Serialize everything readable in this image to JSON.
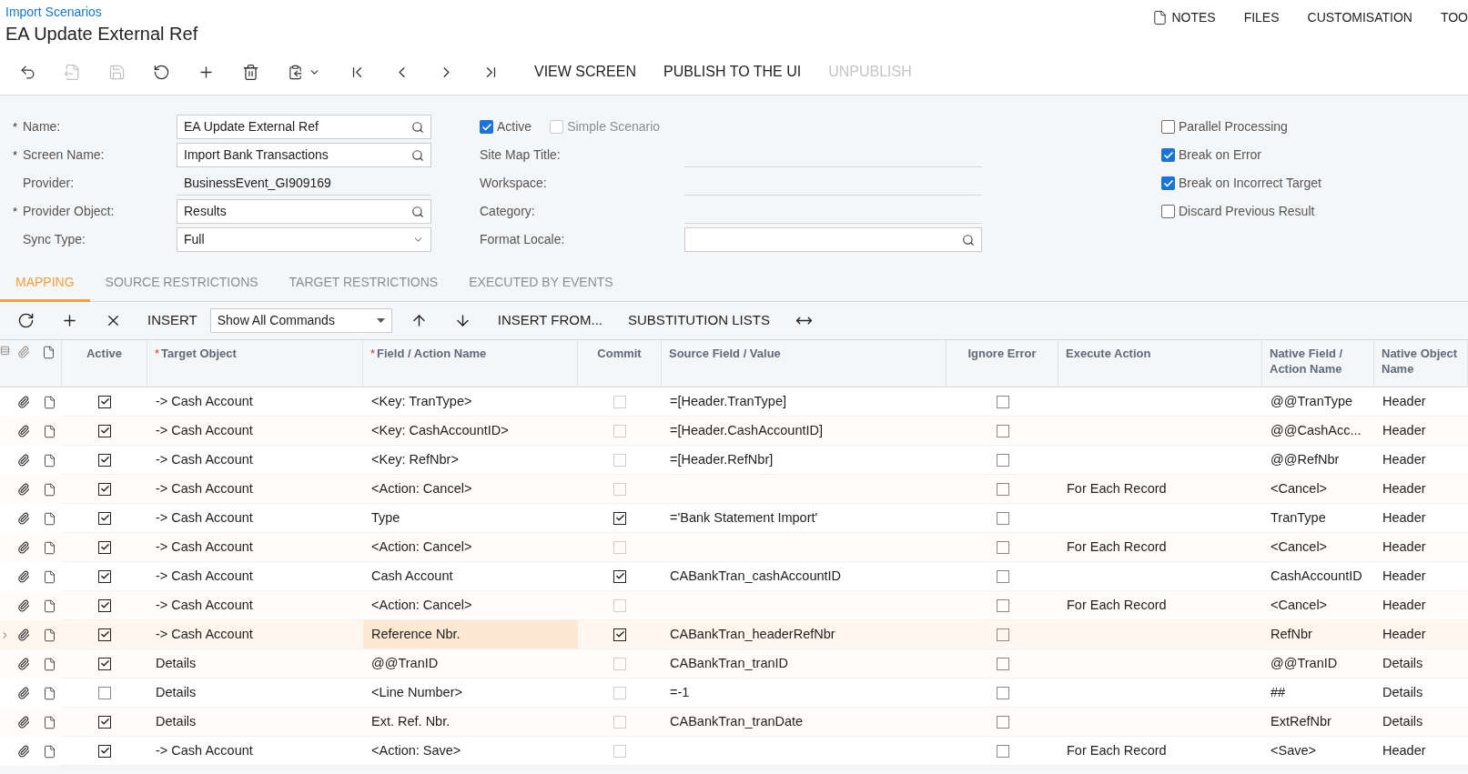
{
  "breadcrumb": "Import Scenarios",
  "title": "EA Update External Ref",
  "top_links": [
    {
      "label": "NOTES",
      "kind": "note"
    },
    {
      "label": "FILES",
      "kind": "plain"
    },
    {
      "label": "CUSTOMISATION",
      "kind": "plain"
    },
    {
      "label": "TOO",
      "kind": "plain"
    }
  ],
  "toolbar": {
    "icon_buttons": [
      {
        "kind": "back",
        "disabled": false
      },
      {
        "kind": "save-close",
        "disabled": true
      },
      {
        "kind": "save",
        "disabled": true
      },
      {
        "kind": "undo",
        "disabled": false
      },
      {
        "kind": "add",
        "disabled": false
      },
      {
        "kind": "delete",
        "disabled": false
      },
      {
        "kind": "copy-paste",
        "disabled": false
      },
      {
        "kind": "first",
        "disabled": false
      },
      {
        "kind": "previous",
        "disabled": false
      },
      {
        "kind": "next",
        "disabled": false
      },
      {
        "kind": "last",
        "disabled": false
      }
    ],
    "text_buttons": [
      {
        "label": "VIEW SCREEN",
        "disabled": false
      },
      {
        "label": "PUBLISH TO THE UI",
        "disabled": false
      },
      {
        "label": "UNPUBLISH",
        "disabled": true
      }
    ]
  },
  "form": {
    "left_fields": [
      {
        "required_mark": "*",
        "label": "Name:",
        "value": "EA Update External Ref",
        "kind": "lookup"
      },
      {
        "required_mark": "*",
        "label": "Screen Name:",
        "value": "Import Bank Transactions",
        "kind": "lookup"
      },
      {
        "label": "Provider:",
        "value": "BusinessEvent_GI909169",
        "kind": "text"
      },
      {
        "required_mark": "*",
        "label": "Provider Object:",
        "value": "Results",
        "kind": "lookup"
      },
      {
        "label": "Sync Type:",
        "value": "Full",
        "kind": "select"
      }
    ],
    "middle_checkboxes": [
      {
        "label": "Active",
        "checked": true,
        "disabled": false
      },
      {
        "label": "Simple Scenario",
        "checked": false,
        "disabled": true
      }
    ],
    "middle_fields": [
      {
        "label": "Site Map Title:",
        "kind": "text"
      },
      {
        "label": "Workspace:",
        "kind": "text"
      },
      {
        "label": "Category:",
        "kind": "text"
      },
      {
        "label": "Format Locale:",
        "kind": "lookup"
      }
    ],
    "right_checkboxes": [
      {
        "label": "Parallel Processing",
        "checked": false
      },
      {
        "label": "Break on Error",
        "checked": true
      },
      {
        "label": "Break on Incorrect Target",
        "checked": true
      },
      {
        "label": "Discard Previous Result",
        "checked": false
      }
    ]
  },
  "tabs": [
    {
      "label": "MAPPING",
      "selected": true
    },
    {
      "label": "SOURCE RESTRICTIONS",
      "selected": false
    },
    {
      "label": "TARGET RESTRICTIONS",
      "selected": false
    },
    {
      "label": "EXECUTED BY EVENTS",
      "selected": false
    }
  ],
  "grid_toolbar": [
    {
      "kind": "refresh"
    },
    {
      "kind": "add"
    },
    {
      "kind": "delete"
    },
    {
      "kind": "text",
      "label": "INSERT"
    },
    {
      "kind": "dropdown",
      "value": "Show All Commands"
    },
    {
      "kind": "up"
    },
    {
      "kind": "down"
    },
    {
      "kind": "text",
      "label": "INSERT FROM..."
    },
    {
      "kind": "text",
      "label": "SUBSTITUTION LISTS"
    },
    {
      "kind": "fit"
    }
  ],
  "columns": [
    {
      "label": "Active"
    },
    {
      "required_mark": "*",
      "label": "Target Object"
    },
    {
      "required_mark": "*",
      "label": "Field / Action Name"
    },
    {
      "label": "Commit"
    },
    {
      "label": "Source Field / Value"
    },
    {
      "label": "Ignore Error"
    },
    {
      "label": "Execute Action"
    },
    {
      "label": "Native Field / Action Name"
    },
    {
      "label": "Native Object Name"
    }
  ],
  "rows": [
    {
      "selected": false,
      "active": true,
      "target": "-> Cash Account",
      "field": "<Key: TranType>",
      "commit": false,
      "source": "=[Header.TranType]",
      "ignore_error": false,
      "execute": "",
      "native_field": "@@TranType",
      "native_object": "Header"
    },
    {
      "selected": false,
      "active": true,
      "target": "-> Cash Account",
      "field": "<Key: CashAccountID>",
      "commit": false,
      "source": "=[Header.CashAccountID]",
      "ignore_error": false,
      "execute": "",
      "native_field": "@@CashAcc...",
      "native_object": "Header"
    },
    {
      "selected": false,
      "active": true,
      "target": "-> Cash Account",
      "field": "<Key: RefNbr>",
      "commit": false,
      "source": "=[Header.RefNbr]",
      "ignore_error": false,
      "execute": "",
      "native_field": "@@RefNbr",
      "native_object": "Header"
    },
    {
      "selected": false,
      "active": true,
      "target": "-> Cash Account",
      "field": "<Action: Cancel>",
      "commit": false,
      "source": "",
      "ignore_error": false,
      "execute": "For Each Record",
      "native_field": "<Cancel>",
      "native_object": "Header"
    },
    {
      "selected": false,
      "active": true,
      "target": "-> Cash Account",
      "field": "Type",
      "commit": true,
      "source": "='Bank Statement Import'",
      "ignore_error": false,
      "execute": "",
      "native_field": "TranType",
      "native_object": "Header"
    },
    {
      "selected": false,
      "active": true,
      "target": "-> Cash Account",
      "field": "<Action: Cancel>",
      "commit": false,
      "source": "",
      "ignore_error": false,
      "execute": "For Each Record",
      "native_field": "<Cancel>",
      "native_object": "Header"
    },
    {
      "selected": false,
      "active": true,
      "target": "-> Cash Account",
      "field": "Cash Account",
      "commit": true,
      "source": "CABankTran_cashAccountID",
      "ignore_error": false,
      "execute": "",
      "native_field": "CashAccountID",
      "native_object": "Header"
    },
    {
      "selected": false,
      "active": true,
      "target": "-> Cash Account",
      "field": "<Action: Cancel>",
      "commit": false,
      "source": "",
      "ignore_error": false,
      "execute": "For Each Record",
      "native_field": "<Cancel>",
      "native_object": "Header"
    },
    {
      "selected": true,
      "active": true,
      "target": "-> Cash Account",
      "field": "Reference Nbr.",
      "commit": true,
      "source": "CABankTran_headerRefNbr",
      "ignore_error": false,
      "execute": "",
      "native_field": "RefNbr",
      "native_object": "Header"
    },
    {
      "selected": false,
      "active": true,
      "target": "Details",
      "field": "@@TranID",
      "commit": false,
      "source": "CABankTran_tranID",
      "ignore_error": false,
      "execute": "",
      "native_field": "@@TranID",
      "native_object": "Details"
    },
    {
      "selected": false,
      "active": false,
      "target": "Details",
      "field": "<Line Number>",
      "commit": false,
      "source": "=-1",
      "ignore_error": false,
      "execute": "",
      "native_field": "##",
      "native_object": "Details"
    },
    {
      "selected": false,
      "active": true,
      "target": "Details",
      "field": "Ext. Ref. Nbr.",
      "commit": false,
      "source": "CABankTran_tranDate",
      "ignore_error": false,
      "execute": "",
      "native_field": "ExtRefNbr",
      "native_object": "Details"
    },
    {
      "selected": false,
      "active": true,
      "target": "-> Cash Account",
      "field": "<Action: Save>",
      "commit": false,
      "source": "",
      "ignore_error": false,
      "execute": "For Each Record",
      "native_field": "<Save>",
      "native_object": "Header"
    }
  ]
}
